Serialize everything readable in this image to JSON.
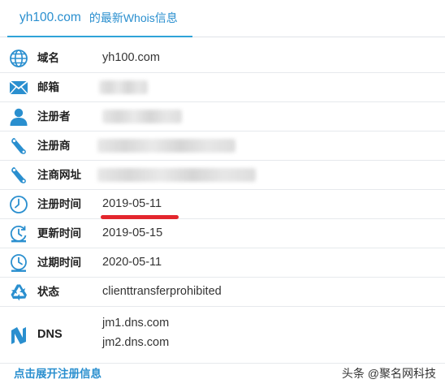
{
  "tab": {
    "domain": "yh100.com",
    "suffix": "的最新Whois信息"
  },
  "rows": [
    {
      "icon": "globe-icon",
      "label": "域名",
      "value": "yh100.com"
    },
    {
      "icon": "envelope-icon",
      "label": "邮箱",
      "value": ""
    },
    {
      "icon": "person-icon",
      "label": "注册者",
      "value": ""
    },
    {
      "icon": "registrar-icon",
      "label": "注册商",
      "value": ""
    },
    {
      "icon": "registrar-url-icon",
      "label": "注商网址",
      "value": ""
    },
    {
      "icon": "clock-icon",
      "label": "注册时间",
      "value": "2019-05-11"
    },
    {
      "icon": "clock-refresh-icon",
      "label": "更新时间",
      "value": "2019-05-15"
    },
    {
      "icon": "clock-expire-icon",
      "label": "过期时间",
      "value": "2020-05-11"
    },
    {
      "icon": "recycle-icon",
      "label": "状态",
      "value": "clienttransferprohibited"
    }
  ],
  "dns": {
    "icon": "dns-icon",
    "label": "DNS",
    "values": [
      "jm1.dns.com",
      "jm2.dns.com"
    ]
  },
  "expand_link": "点击展开注册信息",
  "watermark": "头条 @聚名网科技",
  "colors": {
    "accent": "#2a8fcf",
    "icon_blue": "#2a8fcf",
    "highlight_red": "#e3262d"
  }
}
